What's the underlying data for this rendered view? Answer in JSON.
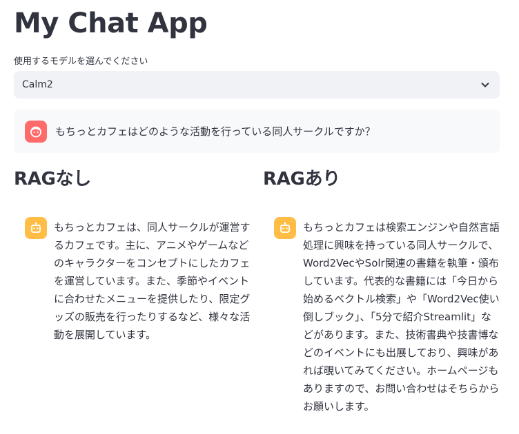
{
  "app": {
    "title": "My Chat App"
  },
  "model_select": {
    "label": "使用するモデルを選んでください",
    "value": "Calm2"
  },
  "user_message": {
    "text": "もちっとカフェはどのような活動を行っている同人サークルですか？"
  },
  "columns": {
    "left": {
      "heading": "RAGなし",
      "response": "もちっとカフェは、同人サークルが運営するカフェです。主に、アニメやゲームなどのキャラクターをコンセプトにしたカフェを運営しています。また、季節やイベントに合わせたメニューを提供したり、限定グッズの販売を行ったりするなど、様々な活動を展開しています。"
    },
    "right": {
      "heading": "RAGあり",
      "response": "もちっとカフェは検索エンジンや自然言語処理に興味を持っている同人サークルで、Word2VecやSolr関連の書籍を執筆・頒布しています。代表的な書籍には「今日から始めるベクトル検索」や「Word2Vec使い倒しブック」、「5分で紹介Streamlit」などがあります。また、技術書典や技書博などのイベントにも出展しており、興味があれば覗いてみてください。ホームページもありますので、お問い合わせはそちらからお願いします。"
    }
  },
  "icons": {
    "user_avatar": "face-icon",
    "bot_avatar": "robot-icon",
    "select_arrow": "chevron-down-icon"
  },
  "colors": {
    "user_avatar_bg": "#ff6b6b",
    "bot_avatar_bg": "#ffbd45",
    "select_bg": "#f0f2f6",
    "text": "#31333f"
  }
}
